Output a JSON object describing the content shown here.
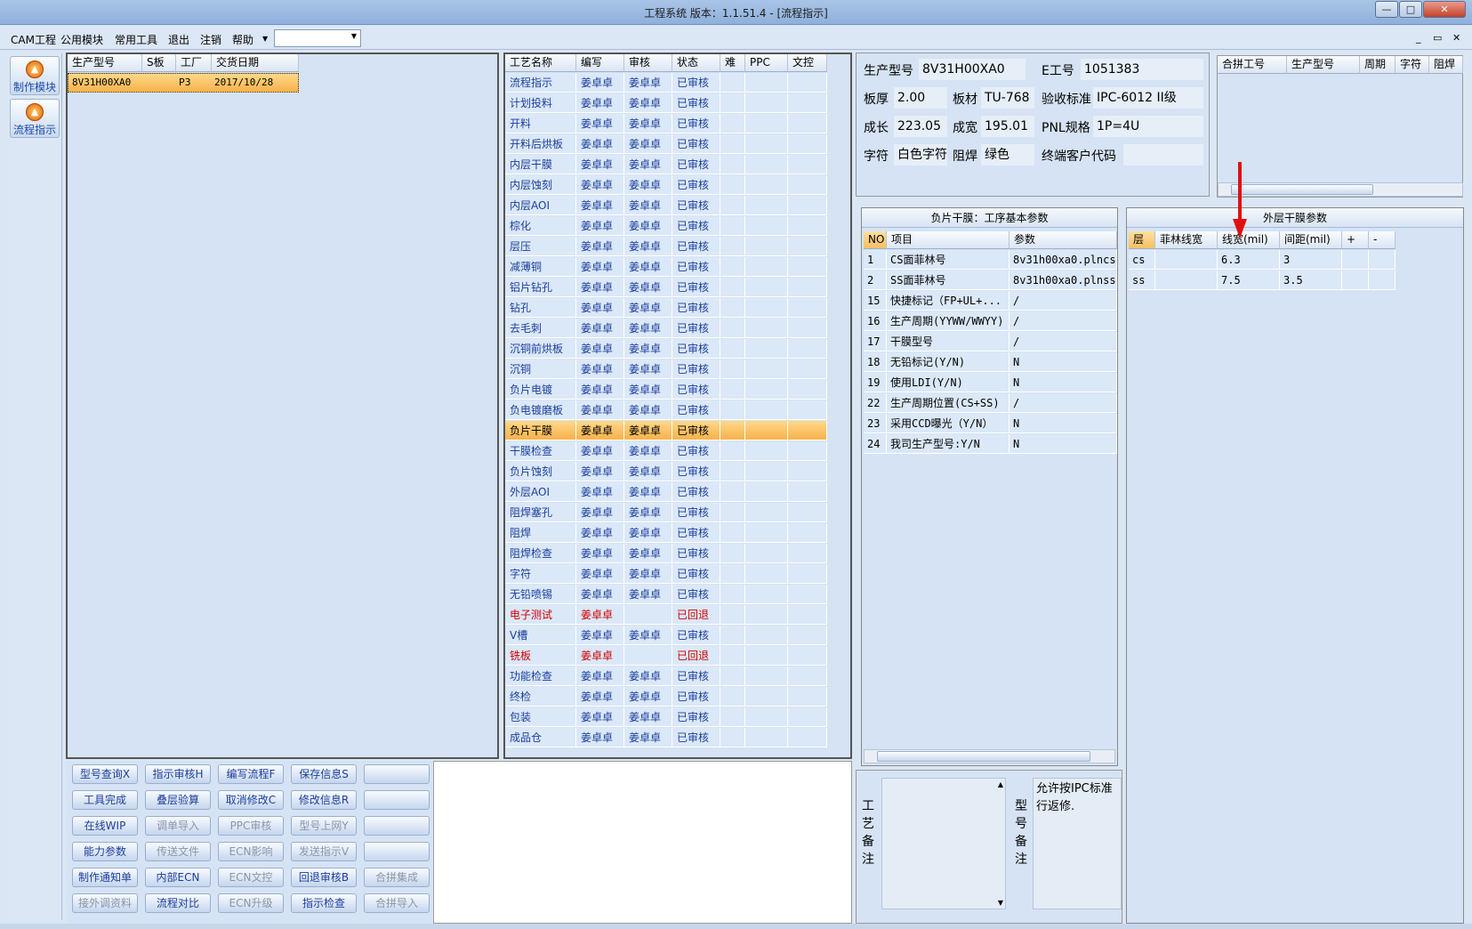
{
  "window": {
    "title": "工程系统   版本：1.1.51.4 - [流程指示]",
    "controls": [
      "—",
      "□",
      "✕"
    ]
  },
  "menu": {
    "items": [
      "CAM工程",
      "公用模块",
      "常用工具",
      "退出",
      "注销",
      "帮助"
    ],
    "mdi_controls": [
      "_",
      "▭",
      "✕"
    ]
  },
  "toolbar": {
    "buttons": [
      {
        "label": "制作模块",
        "icon": "flame-icon"
      },
      {
        "label": "流程指示",
        "icon": "flame-icon"
      }
    ]
  },
  "orders": {
    "columns": [
      "生产型号",
      "S板",
      "工厂",
      "交货日期"
    ],
    "rows": [
      [
        "8V31H00XA0",
        "",
        "P3",
        "2017/10/28"
      ]
    ]
  },
  "process": {
    "columns": [
      "工艺名称",
      "编写",
      "审核",
      "状态",
      "难",
      "PPC",
      "文控"
    ],
    "rows": [
      {
        "name": "流程指示",
        "writer": "姜卓卓",
        "reviewer": "姜卓卓",
        "status": "已审核"
      },
      {
        "name": "计划投料",
        "writer": "姜卓卓",
        "reviewer": "姜卓卓",
        "status": "已审核"
      },
      {
        "name": "开料",
        "writer": "姜卓卓",
        "reviewer": "姜卓卓",
        "status": "已审核"
      },
      {
        "name": "开料后烘板",
        "writer": "姜卓卓",
        "reviewer": "姜卓卓",
        "status": "已审核"
      },
      {
        "name": "内层干膜",
        "writer": "姜卓卓",
        "reviewer": "姜卓卓",
        "status": "已审核"
      },
      {
        "name": "内层蚀刻",
        "writer": "姜卓卓",
        "reviewer": "姜卓卓",
        "status": "已审核"
      },
      {
        "name": "内层AOI",
        "writer": "姜卓卓",
        "reviewer": "姜卓卓",
        "status": "已审核"
      },
      {
        "name": "棕化",
        "writer": "姜卓卓",
        "reviewer": "姜卓卓",
        "status": "已审核"
      },
      {
        "name": "层压",
        "writer": "姜卓卓",
        "reviewer": "姜卓卓",
        "status": "已审核"
      },
      {
        "name": "减薄铜",
        "writer": "姜卓卓",
        "reviewer": "姜卓卓",
        "status": "已审核"
      },
      {
        "name": "铝片钻孔",
        "writer": "姜卓卓",
        "reviewer": "姜卓卓",
        "status": "已审核"
      },
      {
        "name": "钻孔",
        "writer": "姜卓卓",
        "reviewer": "姜卓卓",
        "status": "已审核"
      },
      {
        "name": "去毛刺",
        "writer": "姜卓卓",
        "reviewer": "姜卓卓",
        "status": "已审核"
      },
      {
        "name": "沉铜前烘板",
        "writer": "姜卓卓",
        "reviewer": "姜卓卓",
        "status": "已审核"
      },
      {
        "name": "沉铜",
        "writer": "姜卓卓",
        "reviewer": "姜卓卓",
        "status": "已审核"
      },
      {
        "name": "负片电镀",
        "writer": "姜卓卓",
        "reviewer": "姜卓卓",
        "status": "已审核"
      },
      {
        "name": "负电镀磨板",
        "writer": "姜卓卓",
        "reviewer": "姜卓卓",
        "status": "已审核"
      },
      {
        "name": "负片干膜",
        "writer": "姜卓卓",
        "reviewer": "姜卓卓",
        "status": "已审核",
        "selected": true
      },
      {
        "name": "干膜检查",
        "writer": "姜卓卓",
        "reviewer": "姜卓卓",
        "status": "已审核"
      },
      {
        "name": "负片蚀刻",
        "writer": "姜卓卓",
        "reviewer": "姜卓卓",
        "status": "已审核"
      },
      {
        "name": "外层AOI",
        "writer": "姜卓卓",
        "reviewer": "姜卓卓",
        "status": "已审核"
      },
      {
        "name": "阻焊塞孔",
        "writer": "姜卓卓",
        "reviewer": "姜卓卓",
        "status": "已审核"
      },
      {
        "name": "阻焊",
        "writer": "姜卓卓",
        "reviewer": "姜卓卓",
        "status": "已审核"
      },
      {
        "name": "阻焊检查",
        "writer": "姜卓卓",
        "reviewer": "姜卓卓",
        "status": "已审核"
      },
      {
        "name": "字符",
        "writer": "姜卓卓",
        "reviewer": "姜卓卓",
        "status": "已审核"
      },
      {
        "name": "无铅喷锡",
        "writer": "姜卓卓",
        "reviewer": "姜卓卓",
        "status": "已审核"
      },
      {
        "name": "电子测试",
        "writer": "姜卓卓",
        "reviewer": "",
        "status": "已回退",
        "returned": true
      },
      {
        "name": "V槽",
        "writer": "姜卓卓",
        "reviewer": "姜卓卓",
        "status": "已审核"
      },
      {
        "name": "铣板",
        "writer": "姜卓卓",
        "reviewer": "",
        "status": "已回退",
        "returned": true
      },
      {
        "name": "功能检查",
        "writer": "姜卓卓",
        "reviewer": "姜卓卓",
        "status": "已审核"
      },
      {
        "name": "终检",
        "writer": "姜卓卓",
        "reviewer": "姜卓卓",
        "status": "已审核"
      },
      {
        "name": "包装",
        "writer": "姜卓卓",
        "reviewer": "姜卓卓",
        "status": "已审核"
      },
      {
        "name": "成品仓",
        "writer": "姜卓卓",
        "reviewer": "姜卓卓",
        "status": "已审核"
      }
    ]
  },
  "actions": {
    "rows": [
      [
        {
          "l": "型号查询X",
          "e": true
        },
        {
          "l": "指示审核H",
          "e": true
        },
        {
          "l": "编写流程F",
          "e": true
        },
        {
          "l": "保存信息S",
          "e": true
        },
        {
          "l": "",
          "e": true
        }
      ],
      [
        {
          "l": "工具完成",
          "e": true
        },
        {
          "l": "叠层验算",
          "e": true
        },
        {
          "l": "取消修改C",
          "e": true
        },
        {
          "l": "修改信息R",
          "e": true
        },
        {
          "l": "",
          "e": true
        }
      ],
      [
        {
          "l": "在线WIP",
          "e": true
        },
        {
          "l": "调单导入",
          "e": false
        },
        {
          "l": "PPC审核",
          "e": false
        },
        {
          "l": "型号上网Y",
          "e": false
        },
        {
          "l": "",
          "e": true
        }
      ],
      [
        {
          "l": "能力参数",
          "e": true
        },
        {
          "l": "传送文件",
          "e": false
        },
        {
          "l": "ECN影响",
          "e": false
        },
        {
          "l": "发送指示V",
          "e": false
        },
        {
          "l": "",
          "e": true
        }
      ],
      [
        {
          "l": "制作通知单",
          "e": true
        },
        {
          "l": "内部ECN",
          "e": true
        },
        {
          "l": "ECN文控",
          "e": false
        },
        {
          "l": "回退审核B",
          "e": true
        },
        {
          "l": "合拼集成",
          "e": false
        }
      ],
      [
        {
          "l": "接外调资料",
          "e": false
        },
        {
          "l": "流程对比",
          "e": true
        },
        {
          "l": "ECN升级",
          "e": false
        },
        {
          "l": "指示检查",
          "e": true
        },
        {
          "l": "合拼导入",
          "e": false
        }
      ]
    ]
  },
  "info": {
    "model_label": "生产型号",
    "model": "8V31H00XA0",
    "eno_label": "E工号",
    "eno": "1051383",
    "thick_label": "板厚",
    "thick": "2.00",
    "material_label": "板材",
    "material": "TU-768",
    "std_label": "验收标准",
    "std": "IPC-6012 II级",
    "len_label": "成长",
    "len": "223.05",
    "wid_label": "成宽",
    "wid": "195.01",
    "pnl_label": "PNL规格",
    "pnl": "1P=4U",
    "char_label": "字符",
    "char": "白色字符",
    "mask_label": "阻焊",
    "mask": "绿色",
    "cust_label": "终端客户代码",
    "cust": ""
  },
  "combine": {
    "columns": [
      "合拼工号",
      "生产型号",
      "周期",
      "字符",
      "阻焊"
    ]
  },
  "basic": {
    "title": "负片干膜：工序基本参数",
    "columns": [
      "NO",
      "项目",
      "参数"
    ],
    "rows": [
      [
        "1",
        "CS面菲林号",
        "8v31h00xa0.plncs"
      ],
      [
        "2",
        "SS面菲林号",
        "8v31h00xa0.plnss"
      ],
      [
        "15",
        "快捷标记（FP+UL+...",
        "/"
      ],
      [
        "16",
        "生产周期(YYWW/WWYY)",
        "/"
      ],
      [
        "17",
        "干膜型号",
        "/"
      ],
      [
        "18",
        "无铅标记(Y/N)",
        "N"
      ],
      [
        "19",
        "使用LDI(Y/N)",
        "N"
      ],
      [
        "22",
        "生产周期位置(CS+SS)",
        "/"
      ],
      [
        "23",
        "采用CCD曝光（Y/N）",
        "N"
      ],
      [
        "24",
        "我司生产型号:Y/N",
        "N"
      ]
    ]
  },
  "outer": {
    "title": "外层干膜参数",
    "columns": [
      "层",
      "菲林线宽",
      "线宽(mil)",
      "间距(mil)",
      "+",
      "-"
    ],
    "rows": [
      [
        "cs",
        "",
        "6.3",
        "3",
        "",
        ""
      ],
      [
        "ss",
        "",
        "7.5",
        "3.5",
        "",
        ""
      ]
    ]
  },
  "notes": {
    "process_label": "工艺备注",
    "model_label": "型号备注",
    "model_note": "允许按IPC标准行返修."
  },
  "annotation": {
    "color": "#e01010"
  }
}
